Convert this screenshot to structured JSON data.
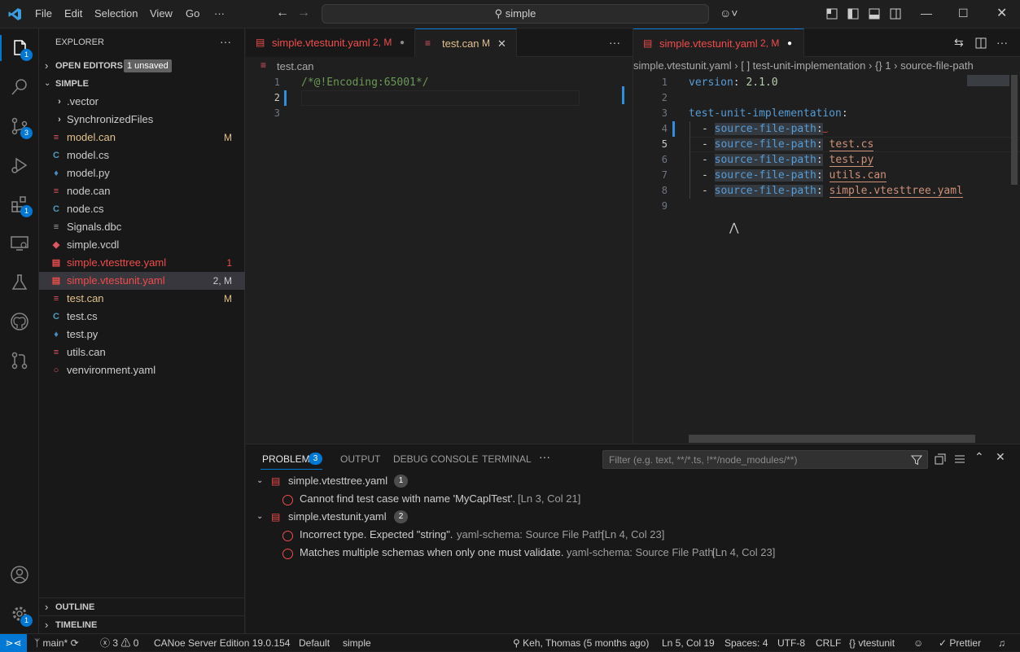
{
  "menu": {
    "file": "File",
    "edit": "Edit",
    "selection": "Selection",
    "view": "View",
    "go": "Go",
    "more": "···"
  },
  "search": {
    "text": "simple"
  },
  "activity": {
    "explorer_badge": "1",
    "scm_badge": "3",
    "extensions_badge": "1",
    "settings_badge": "1"
  },
  "sidebar": {
    "title": "EXPLORER",
    "more": "···",
    "open_editors": "OPEN EDITORS",
    "unsaved_badge": "1 unsaved",
    "folder": "SIMPLE",
    "items": [
      {
        "name": ".vector",
        "status": "",
        "icon": "folder",
        "color": "#cccccc",
        "statcolor": "#cccccc"
      },
      {
        "name": "SynchronizedFiles",
        "status": "",
        "icon": "folder",
        "color": "#cccccc",
        "statcolor": "#cccccc"
      },
      {
        "name": "model.can",
        "status": "M",
        "icon": "can",
        "color": "#e2c08d",
        "statcolor": "#e2c08d"
      },
      {
        "name": "model.cs",
        "status": "",
        "icon": "cs",
        "color": "#cccccc",
        "statcolor": "#cccccc"
      },
      {
        "name": "model.py",
        "status": "",
        "icon": "py",
        "color": "#cccccc",
        "statcolor": "#cccccc"
      },
      {
        "name": "node.can",
        "status": "",
        "icon": "can",
        "color": "#cccccc",
        "statcolor": "#cccccc"
      },
      {
        "name": "node.cs",
        "status": "",
        "icon": "cs",
        "color": "#cccccc",
        "statcolor": "#cccccc"
      },
      {
        "name": "Signals.dbc",
        "status": "",
        "icon": "dbc",
        "color": "#cccccc",
        "statcolor": "#cccccc"
      },
      {
        "name": "simple.vcdl",
        "status": "",
        "icon": "vcdl",
        "color": "#cccccc",
        "statcolor": "#cccccc"
      },
      {
        "name": "simple.vtesttree.yaml",
        "status": "1",
        "icon": "tree",
        "color": "#f14c4c",
        "statcolor": "#f14c4c"
      },
      {
        "name": "simple.vtestunit.yaml",
        "status": "2, M",
        "icon": "unit",
        "color": "#f14c4c",
        "statcolor": "#cccccc"
      },
      {
        "name": "test.can",
        "status": "M",
        "icon": "can",
        "color": "#e2c08d",
        "statcolor": "#e2c08d"
      },
      {
        "name": "test.cs",
        "status": "",
        "icon": "cs",
        "color": "#cccccc",
        "statcolor": "#cccccc"
      },
      {
        "name": "test.py",
        "status": "",
        "icon": "py",
        "color": "#cccccc",
        "statcolor": "#cccccc"
      },
      {
        "name": "utils.can",
        "status": "",
        "icon": "can",
        "color": "#cccccc",
        "statcolor": "#cccccc"
      },
      {
        "name": "venvironment.yaml",
        "status": "",
        "icon": "venv",
        "color": "#cccccc",
        "statcolor": "#cccccc"
      }
    ],
    "outline": "OUTLINE",
    "timeline": "TIMELINE"
  },
  "left_editor": {
    "tab1": {
      "name": "simple.vtestunit.yaml",
      "status": "2, M"
    },
    "tab2": {
      "name": "test.can",
      "status": "M"
    },
    "breadcrumb": "test.can",
    "lines": [
      "/*@!Encoding:65001*/",
      "",
      ""
    ],
    "line_numbers": [
      "1",
      "2",
      "3"
    ]
  },
  "right_editor": {
    "tab": {
      "name": "simple.vtestunit.yaml",
      "status": "2, M"
    },
    "breadcrumb": {
      "file": "simple.vtestunit.yaml",
      "seg1": "[ ] test-unit-implementation",
      "seg2": "{} 1",
      "seg3": "source-file-path"
    },
    "line_numbers": [
      "1",
      "2",
      "3",
      "4",
      "5",
      "6",
      "7",
      "8",
      "9"
    ],
    "code": {
      "l1_key": "version",
      "l1_val": "2.1.0",
      "l3_key": "test-unit-implementation",
      "item_key": "source-file-path",
      "l5_val": "test.cs",
      "l6_val": "test.py",
      "l7_val": "utils.can",
      "l8_val": "simple.vtesttree.yaml"
    }
  },
  "panel": {
    "tabs": {
      "problems": "PROBLEMS",
      "problems_count": "3",
      "output": "OUTPUT",
      "debug": "DEBUG CONSOLE",
      "terminal": "TERMINAL",
      "more": "···"
    },
    "filter_placeholder": "Filter (e.g. text, **/*.ts, !**/node_modules/**)",
    "groups": [
      {
        "file": "simple.vtesttree.yaml",
        "count": "1"
      },
      {
        "file": "simple.vtestunit.yaml",
        "count": "2"
      }
    ],
    "problems": [
      {
        "msg": "Cannot find test case with name 'MyCaplTest'.",
        "source": "",
        "loc": "[Ln 3, Col 21]"
      },
      {
        "msg": "Incorrect type. Expected \"string\".",
        "source": "yaml-schema: Source File Path",
        "loc": "[Ln 4, Col 23]"
      },
      {
        "msg": "Matches multiple schemas when only one must validate.",
        "source": "yaml-schema: Source File Path",
        "loc": "[Ln 4, Col 23]"
      }
    ]
  },
  "status": {
    "branch": "main*",
    "errors": "3",
    "warnings": "0",
    "server": "CANoe Server Edition 19.0.154",
    "profile": "Default",
    "workspace": "simple",
    "blame": "Keh, Thomas (5 months ago)",
    "position": "Ln 5, Col 19",
    "spaces": "Spaces: 4",
    "encoding": "UTF-8",
    "eol": "CRLF",
    "language": "vtestunit",
    "prettier": "Prettier"
  }
}
